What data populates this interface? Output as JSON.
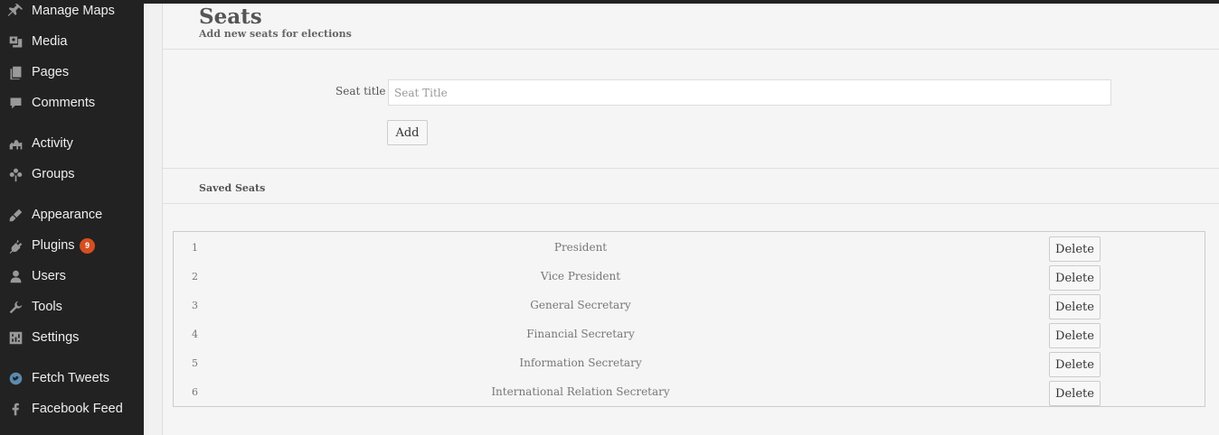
{
  "sidebar": {
    "items": [
      {
        "label": "Manage Maps",
        "icon": "pushpin-icon"
      },
      {
        "label": "Media",
        "icon": "media-icon"
      },
      {
        "label": "Pages",
        "icon": "pages-icon"
      },
      {
        "label": "Comments",
        "icon": "comment-icon"
      },
      {
        "label": "Activity",
        "icon": "activity-icon"
      },
      {
        "label": "Groups",
        "icon": "groups-icon"
      },
      {
        "label": "Appearance",
        "icon": "paintbrush-icon"
      },
      {
        "label": "Plugins",
        "icon": "plugin-icon",
        "badge": "9"
      },
      {
        "label": "Users",
        "icon": "user-icon"
      },
      {
        "label": "Tools",
        "icon": "wrench-icon"
      },
      {
        "label": "Settings",
        "icon": "settings-icon"
      },
      {
        "label": "Fetch Tweets",
        "icon": "twitter-icon"
      },
      {
        "label": "Facebook Feed",
        "icon": "facebook-icon"
      }
    ]
  },
  "header": {
    "title": "Seats",
    "subtitle": "Add new seats for elections"
  },
  "form": {
    "seat_title_label": "Seat title",
    "seat_title_placeholder": "Seat Title",
    "seat_title_value": "",
    "add_label": "Add"
  },
  "saved": {
    "heading": "Saved Seats",
    "rows": [
      {
        "num": "1",
        "name": "President",
        "delete_label": "Delete"
      },
      {
        "num": "2",
        "name": "Vice President",
        "delete_label": "Delete"
      },
      {
        "num": "3",
        "name": "General Secretary",
        "delete_label": "Delete"
      },
      {
        "num": "4",
        "name": "Financial Secretary",
        "delete_label": "Delete"
      },
      {
        "num": "5",
        "name": "Information Secretary",
        "delete_label": "Delete"
      },
      {
        "num": "6",
        "name": "International Relation Secretary",
        "delete_label": "Delete"
      }
    ]
  },
  "colors": {
    "sidebar_bg": "#222222",
    "badge": "#d54e21",
    "panel_bg": "#f5f5f5"
  }
}
